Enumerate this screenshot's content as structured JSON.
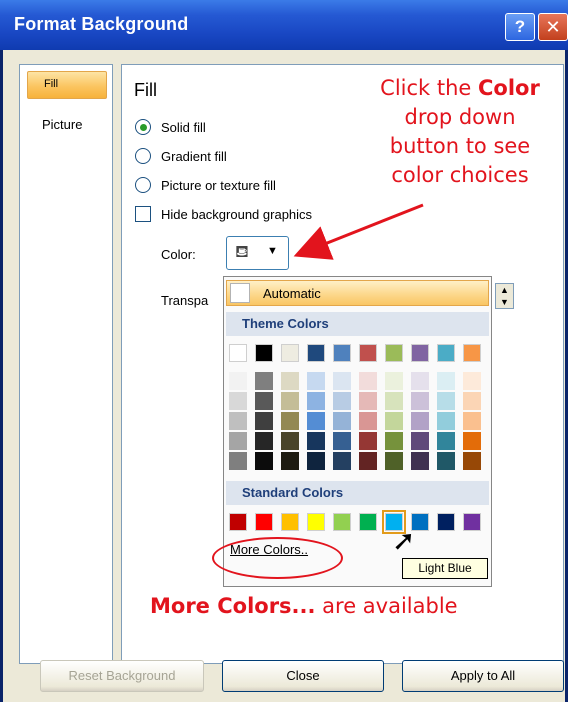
{
  "window": {
    "title": "Format Background",
    "help_label": "?",
    "close_label": "✕"
  },
  "sidebar": {
    "items": [
      {
        "label": "Fill",
        "selected": true
      },
      {
        "label": "Picture",
        "selected": false
      }
    ]
  },
  "panel": {
    "heading": "Fill",
    "options": [
      {
        "label": "Solid fill",
        "selected": true
      },
      {
        "label": "Gradient fill",
        "selected": false
      },
      {
        "label": "Picture or texture fill",
        "selected": false
      }
    ],
    "checkbox_label": "Hide background graphics",
    "color_label": "Color:",
    "transparency_label": "Transpa",
    "color_button_icon": "paint-bucket-icon"
  },
  "dropdown": {
    "automatic_label": "Automatic",
    "theme_header": "Theme Colors",
    "theme_colors": [
      "#ffffff",
      "#000000",
      "#eeece1",
      "#1f497d",
      "#4f81bd",
      "#c0504d",
      "#9bbb59",
      "#8064a2",
      "#4bacc6",
      "#f79646"
    ],
    "theme_shades": [
      [
        "#f2f2f2",
        "#d8d8d8",
        "#bfbfbf",
        "#a5a5a5",
        "#7f7f7f"
      ],
      [
        "#7f7f7f",
        "#595959",
        "#3f3f3f",
        "#262626",
        "#0c0c0c"
      ],
      [
        "#ddd9c3",
        "#c4bd97",
        "#938953",
        "#494429",
        "#1d1b10"
      ],
      [
        "#c6d9f0",
        "#8db3e2",
        "#548dd4",
        "#17365d",
        "#0f243e"
      ],
      [
        "#dbe5f1",
        "#b8cce4",
        "#95b3d7",
        "#366092",
        "#244061"
      ],
      [
        "#f2dcdb",
        "#e5b9b7",
        "#d99694",
        "#953734",
        "#632423"
      ],
      [
        "#ebf1dd",
        "#d7e3bc",
        "#c3d69b",
        "#76923c",
        "#4f6128"
      ],
      [
        "#e5e0ec",
        "#ccc1d9",
        "#b2a2c7",
        "#5f497a",
        "#3f3151"
      ],
      [
        "#dbeef3",
        "#b7dde8",
        "#92cddc",
        "#31859b",
        "#205867"
      ],
      [
        "#fdeada",
        "#fbd5b5",
        "#fac08f",
        "#e36c09",
        "#974806"
      ]
    ],
    "standard_header": "Standard Colors",
    "standard_colors": [
      "#c00000",
      "#ff0000",
      "#ffc000",
      "#ffff00",
      "#92d050",
      "#00b050",
      "#00b0f0",
      "#0070c0",
      "#002060",
      "#7030a0"
    ],
    "selected_standard_index": 6,
    "more_colors_label": "More Colors..",
    "tooltip": "Light Blue"
  },
  "annotations": {
    "top_lines": [
      {
        "pre": "Click the ",
        "bold": "Color"
      },
      {
        "pre": "drop down",
        "bold": ""
      },
      {
        "pre": "button to see",
        "bold": ""
      },
      {
        "pre": "color choices",
        "bold": ""
      }
    ],
    "bottom_bold": "More Colors...",
    "bottom_rest": " are available"
  },
  "buttons": {
    "reset": "Reset Background",
    "close": "Close",
    "apply": "Apply to All"
  },
  "colors": {
    "annotation_red": "#e2141d",
    "title_blue": "#1846c2"
  }
}
